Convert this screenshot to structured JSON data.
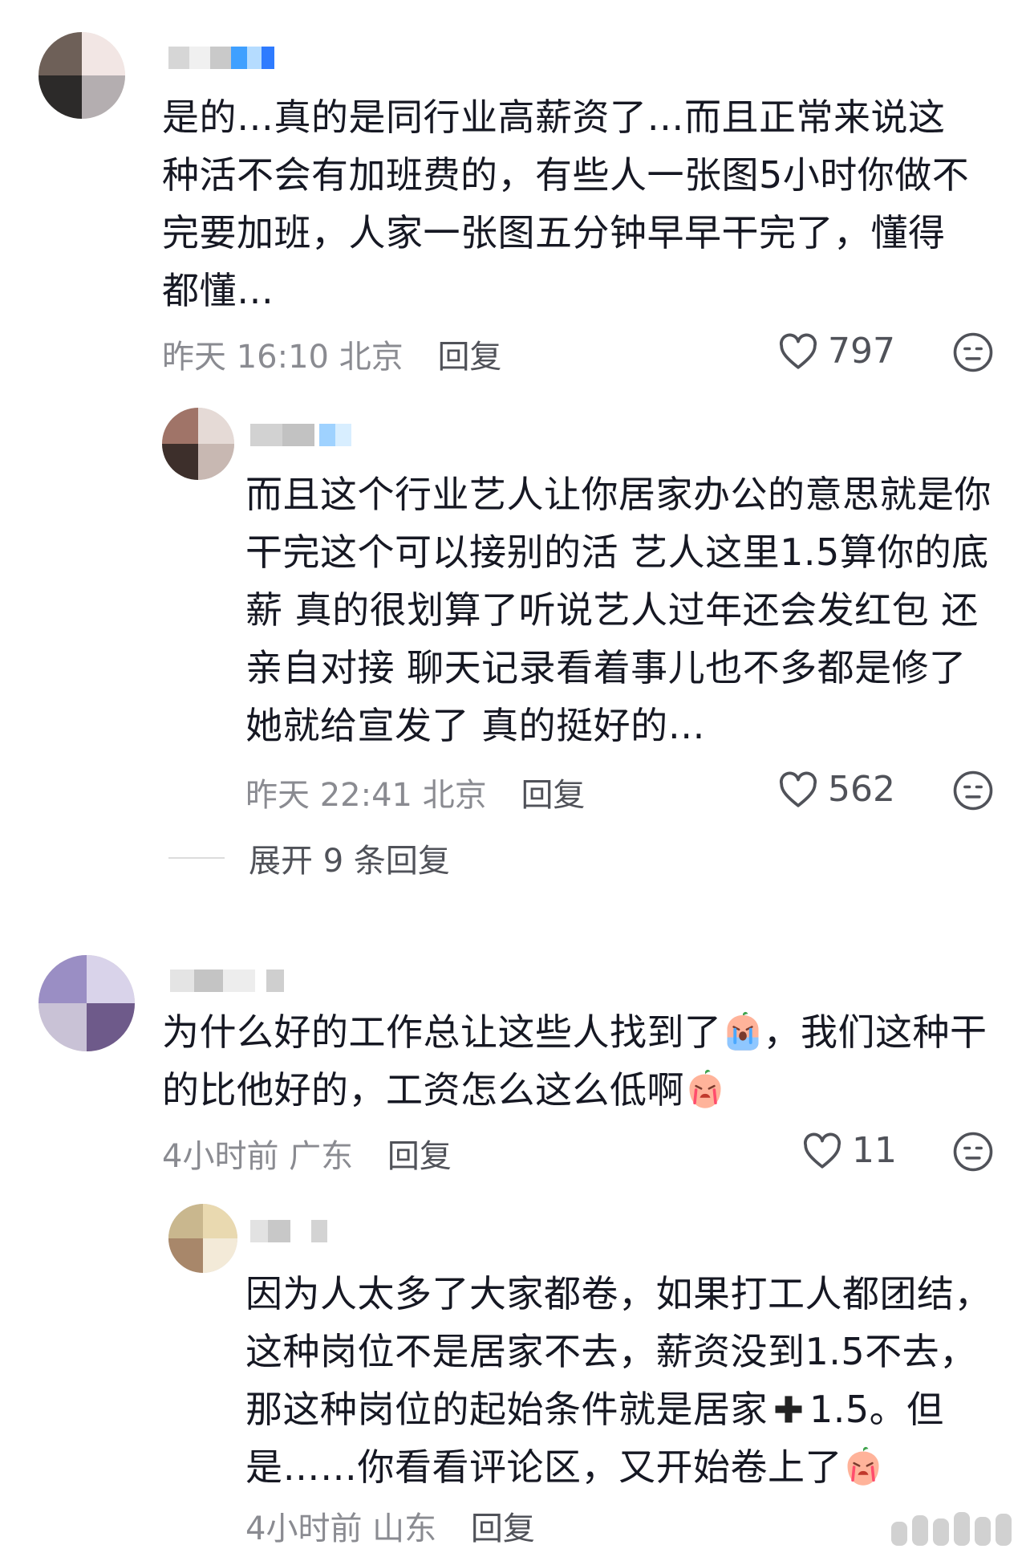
{
  "comments": [
    {
      "text": "是的…真的是同行业高薪资了…而且正常来说这种活不会有加班费的，有些人一张图5小时你做不完要加班，人家一张图五分钟早早干完了，懂得都懂…",
      "time": "昨天 16:10",
      "location": "北京",
      "reply_label": "回复",
      "likes": "797"
    },
    {
      "text": "而且这个行业艺人让你居家办公的意思就是你干完这个可以接别的活 艺人这里1.5算你的底薪 真的很划算了听说艺人过年还会发红包 还亲自对接 聊天记录看着事儿也不多都是修了她就给宣发了 真的挺好的…",
      "time": "昨天 22:41",
      "location": "北京",
      "reply_label": "回复",
      "likes": "562"
    },
    {
      "text_a": "为什么好的工作总让这些人找到了",
      "text_b": "，我们这种干的比他好的，工资怎么这么低啊",
      "time": "4小时前",
      "location": "广东",
      "reply_label": "回复",
      "likes": "11"
    },
    {
      "text_a": "因为人太多了大家都卷，如果打工人都团结，这种岗位不是居家不去，薪资没到1.5不去，那这种岗位的起始条件就是居家",
      "text_b": "1.5。但是……你看看评论区，又开始卷上了",
      "time": "4小时前",
      "location": "山东",
      "reply_label": "回复"
    }
  ],
  "expand_replies": "展开 9 条回复",
  "icons": {
    "like": "heart-outline-icon",
    "dislike": "neutral-face-icon",
    "emoji": "crying-face-emoji",
    "plus": "plus-sign-emoji"
  },
  "colors": {
    "text": "#161823",
    "meta": "#8a8b91",
    "action": "#505259"
  }
}
